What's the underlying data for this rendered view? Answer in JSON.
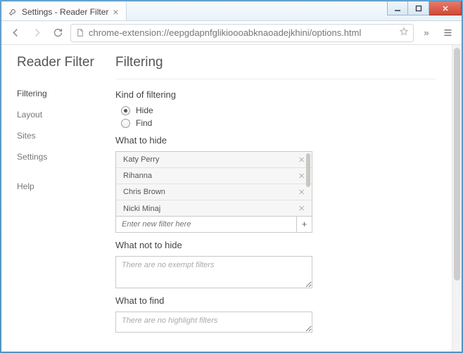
{
  "window": {
    "tab_title": "Settings - Reader Filter",
    "url": "chrome-extension://eepgdapnfglikioooabknaoadejkhini/options.html"
  },
  "app": {
    "title": "Reader Filter",
    "nav": {
      "filtering": "Filtering",
      "layout": "Layout",
      "sites": "Sites",
      "settings": "Settings",
      "help": "Help"
    }
  },
  "page": {
    "title": "Filtering",
    "kind": {
      "heading": "Kind of filtering",
      "hide": "Hide",
      "find": "Find",
      "selected": "hide"
    },
    "hide": {
      "heading": "What to hide",
      "items": [
        "Katy Perry",
        "Rihanna",
        "Chris Brown",
        "Nicki Minaj"
      ],
      "placeholder": "Enter new filter here"
    },
    "not_hide": {
      "heading": "What not to hide",
      "placeholder": "There are no exempt filters"
    },
    "find": {
      "heading": "What to find",
      "placeholder": "There are no highlight filters"
    }
  }
}
